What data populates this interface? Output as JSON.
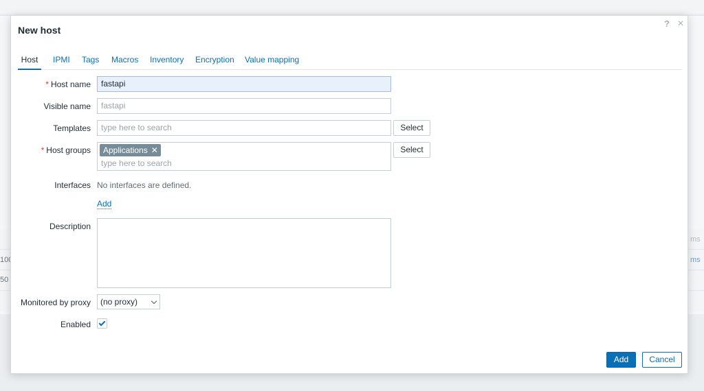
{
  "background": {
    "fragments": [
      "ms",
      "ms",
      "100",
      "50"
    ]
  },
  "dialog": {
    "title": "New host",
    "help_icon": "?",
    "close_icon": "×"
  },
  "tabs": [
    {
      "label": "Host",
      "active": true
    },
    {
      "label": "IPMI"
    },
    {
      "label": "Tags"
    },
    {
      "label": "Macros"
    },
    {
      "label": "Inventory"
    },
    {
      "label": "Encryption"
    },
    {
      "label": "Value mapping"
    }
  ],
  "form": {
    "host_name": {
      "label": "Host name",
      "required": true,
      "value": "fastapi"
    },
    "visible_name": {
      "label": "Visible name",
      "placeholder": "fastapi"
    },
    "templates": {
      "label": "Templates",
      "placeholder": "type here to search",
      "select_label": "Select"
    },
    "host_groups": {
      "label": "Host groups",
      "required": true,
      "selected": [
        "Applications"
      ],
      "remove_icon": "✕",
      "placeholder": "type here to search",
      "select_label": "Select"
    },
    "interfaces": {
      "label": "Interfaces",
      "empty_text": "No interfaces are defined.",
      "add_label": "Add"
    },
    "description": {
      "label": "Description",
      "value": ""
    },
    "proxy": {
      "label": "Monitored by proxy",
      "value": "(no proxy)"
    },
    "enabled": {
      "label": "Enabled",
      "checked": true
    }
  },
  "footer": {
    "add_label": "Add",
    "cancel_label": "Cancel"
  },
  "colors": {
    "accent": "#0b6fb5",
    "required": "#e33734",
    "chip": "#768d99"
  }
}
